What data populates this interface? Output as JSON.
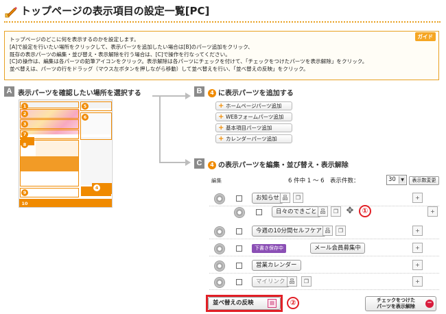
{
  "header": {
    "title": "トップページの表示項目の設定一覧[PC]",
    "icon": "pencil-icon"
  },
  "guide": {
    "tag": "ガイド",
    "lines": [
      "トップページのどこに何を表示するのかを設定します。",
      "[A]で設定を行いたい場所をクリックして、表示パーツを追加したい場合は[B]のパーツ追加をクリック、",
      "既存の表示パーツの編集・並び替え・表示解除を行う場合は、[C]で操作を行なってください。",
      "[C]の操作は、編集は各パーツの鉛筆アイコンをクリック。表示解除は各パーツにチェックを付けて、「チェックをつけたパーツを表示解除」をクリック。",
      "並べ替えは、パーツの行をドラッグ（マウス左ボタンを押しながら移動）して並べ替えを行い、「並べ替えの反映」をクリック。"
    ]
  },
  "section_a": {
    "letter": "A",
    "title": "表示パーツを確認したい場所を選択する",
    "regions": [
      "1",
      "2",
      "3",
      "4",
      "5",
      "6",
      "7",
      "8",
      "9",
      "10"
    ]
  },
  "section_b": {
    "letter": "B",
    "num": "4",
    "title": "に表示パーツを追加する",
    "buttons": [
      "ホームページパーツ追加",
      "WEBフォームパーツ追加",
      "基本項目パーツ追加",
      "カレンダーパーツ追加"
    ]
  },
  "section_c": {
    "letter": "C",
    "num": "4",
    "title": "の表示パーツを編集・並び替え・表示解除",
    "edit_label": "編集",
    "pager_text": "6 件中 1 ～ 6　表示件数：",
    "per_page": "30",
    "change_label": "表示数変更",
    "rows": [
      {
        "label": "お知らせ",
        "draft": ""
      },
      {
        "label": "日々のできごと",
        "draft": ""
      },
      {
        "label": "今週の10分間セルフケア",
        "draft": ""
      },
      {
        "label": "メール会員募集中",
        "draft": "下書き保存中"
      },
      {
        "label": "営業カレンダー",
        "draft": ""
      },
      {
        "label": "マイリンク",
        "draft": ""
      }
    ],
    "callout_1": "①",
    "callout_2": "②",
    "reorder_label": "並べ替えの反映",
    "hide_label_1": "チェックをつけた",
    "hide_label_2": "パーツを表示解除"
  },
  "colors": {
    "accent": "#f08a00",
    "callout": "#e21f26",
    "draft": "#8b4fb5"
  }
}
